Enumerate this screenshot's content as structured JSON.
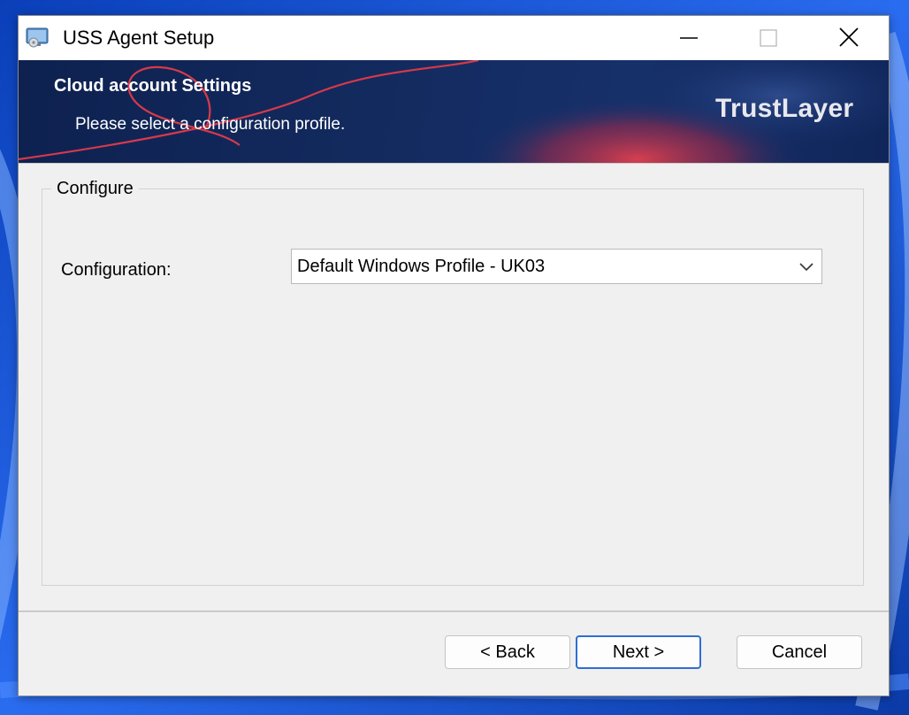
{
  "window": {
    "title": "USS Agent Setup",
    "icon": "setup-app-icon"
  },
  "title_bar": {
    "minimize_icon": "minimize-icon",
    "maximize_icon": "maximize-icon",
    "close_icon": "close-icon"
  },
  "banner": {
    "title": "Cloud account Settings",
    "subtitle": "Please select a configuration profile.",
    "brand": "TrustLayer"
  },
  "configure_group": {
    "legend": "Configure",
    "configuration_label": "Configuration:",
    "configuration_value": "Default Windows Profile - UK03",
    "dropdown_icon": "chevron-down-icon"
  },
  "buttons": {
    "back": "< Back",
    "next": "Next >",
    "cancel": "Cancel"
  },
  "colors": {
    "banner_dark": "#0e2150",
    "banner_accent": "#d8394a",
    "focus_border": "#2f6fd1",
    "desktop": "#1a4fd0"
  }
}
